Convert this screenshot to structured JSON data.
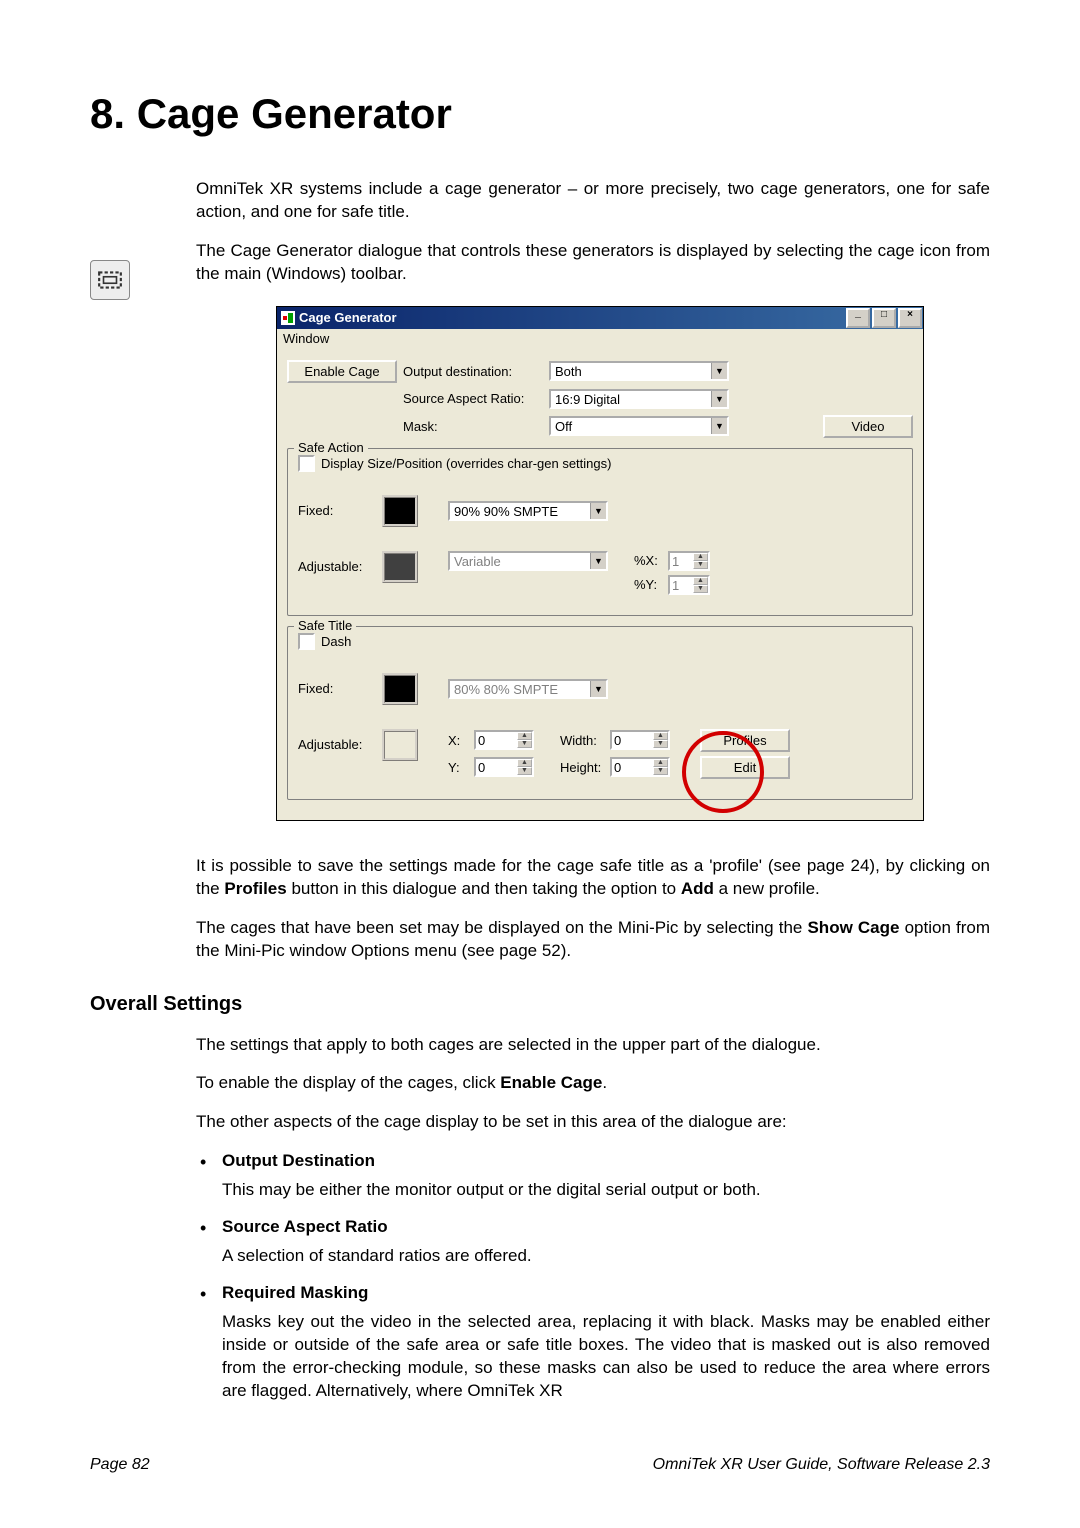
{
  "chapter_title": "8.  Cage Generator",
  "intro_p1": "OmniTek XR systems include a cage generator – or more precisely, two cage generators, one for safe action, and one for safe title.",
  "intro_p2": "The Cage Generator dialogue that controls these generators is displayed by selecting the cage icon from the main (Windows) toolbar.",
  "dialog": {
    "title": "Cage Generator",
    "menu_window": "Window",
    "enable_cage_btn": "Enable Cage",
    "output_dest_lbl": "Output destination:",
    "output_dest_val": "Both",
    "source_ar_lbl": "Source Aspect Ratio:",
    "source_ar_val": "16:9 Digital",
    "mask_lbl": "Mask:",
    "mask_val": "Off",
    "video_btn": "Video",
    "safe_action": {
      "legend": "Safe Action",
      "display_chk": "Display Size/Position (overrides char-gen settings)",
      "fixed_lbl": "Fixed:",
      "fixed_val": "90% 90% SMPTE",
      "adjustable_lbl": "Adjustable:",
      "adjustable_val": "Variable",
      "xx_lbl": "%X:",
      "xx_val": "1",
      "xy_lbl": "%Y:",
      "xy_val": "1"
    },
    "safe_title": {
      "legend": "Safe Title",
      "dash_chk": "Dash",
      "fixed_lbl": "Fixed:",
      "fixed_val": "80% 80% SMPTE",
      "adjustable_lbl": "Adjustable:",
      "x_lbl": "X:",
      "x_val": "0",
      "y_lbl": "Y:",
      "y_val": "0",
      "width_lbl": "Width:",
      "width_val": "0",
      "height_lbl": "Height:",
      "height_val": "0",
      "profiles_btn": "Profiles",
      "edit_btn": "Edit"
    }
  },
  "after1_a": "It is possible to save the settings made for the cage safe title as a 'profile' (see page 24), by clicking on the ",
  "after1_b": "Profiles",
  "after1_c": " button in this dialogue and then taking the option to ",
  "after1_d": "Add",
  "after1_e": " a new profile.",
  "after2_a": "The cages that have been set may be displayed on the Mini-Pic by selecting the ",
  "after2_b": "Show Cage",
  "after2_c": " option from the Mini-Pic window Options menu (see page 52).",
  "overall_heading": "Overall Settings",
  "overall_p1": "The settings that apply to both cages are selected in the upper part of the dialogue.",
  "overall_p2_a": "To enable the display of the cages, click ",
  "overall_p2_b": "Enable Cage",
  "overall_p2_c": ".",
  "overall_p3": "The other aspects of the cage display to be set in this area of the dialogue are:",
  "bullets": {
    "b1_head": "Output Destination",
    "b1_body": "This may be either the monitor output or the digital serial output or both.",
    "b2_head": "Source Aspect Ratio",
    "b2_body": "A selection of standard ratios are offered.",
    "b3_head": "Required Masking",
    "b3_body": "Masks key out the video in the selected area, replacing it with black. Masks may be enabled either inside or outside of the safe area or safe title boxes. The video that is masked out is also removed from the error-checking module, so these masks can also be used to reduce the area where errors are flagged. Alternatively, where OmniTek XR"
  },
  "footer_left": "Page 82",
  "footer_right": "OmniTek XR User Guide, Software Release 2.3"
}
